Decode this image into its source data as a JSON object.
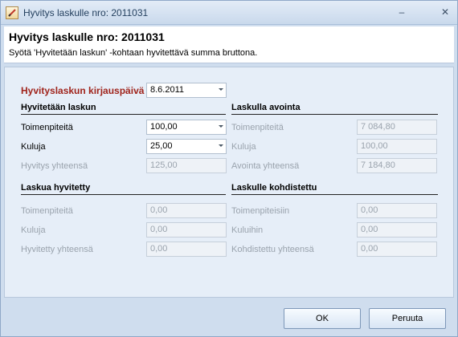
{
  "window": {
    "title": "Hyvitys laskulle nro: 2011031",
    "min_symbol": "–",
    "close_symbol": "✕"
  },
  "header": {
    "title": "Hyvitys laskulle nro: 2011031",
    "subtitle": "Syötä 'Hyvitetään laskun' -kohtaan hyvitettävä summa bruttona."
  },
  "form": {
    "posting_date": {
      "label": "Hyvityslaskun kirjauspäivä",
      "value": "8.6.2011"
    },
    "hyvitetaan": {
      "heading": "Hyvitetään laskun",
      "toimenpiteita": {
        "label": "Toimenpiteitä",
        "value": "100,00"
      },
      "kuluja": {
        "label": "Kuluja",
        "value": "25,00"
      },
      "yhteensa": {
        "label": "Hyvitys yhteensä",
        "value": "125,00"
      }
    },
    "avointa": {
      "heading": "Laskulla avointa",
      "toimenpiteita": {
        "label": "Toimenpiteitä",
        "value": "7 084,80"
      },
      "kuluja": {
        "label": "Kuluja",
        "value": "100,00"
      },
      "yhteensa": {
        "label": "Avointa yhteensä",
        "value": "7 184,80"
      }
    },
    "hyvitetty": {
      "heading": "Laskua hyvitetty",
      "toimenpiteita": {
        "label": "Toimenpiteitä",
        "value": "0,00"
      },
      "kuluja": {
        "label": "Kuluja",
        "value": "0,00"
      },
      "yhteensa": {
        "label": "Hyvitetty yhteensä",
        "value": "0,00"
      }
    },
    "kohdistettu": {
      "heading": "Laskulle kohdistettu",
      "toimenpiteita": {
        "label": "Toimenpiteisiin",
        "value": "0,00"
      },
      "kuluja": {
        "label": "Kuluihin",
        "value": "0,00"
      },
      "yhteensa": {
        "label": "Kohdistettu yhteensä",
        "value": "0,00"
      }
    }
  },
  "buttons": {
    "ok": "OK",
    "cancel": "Peruuta"
  }
}
